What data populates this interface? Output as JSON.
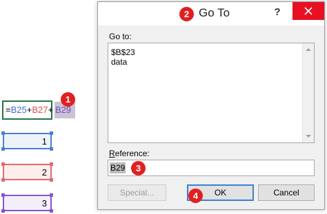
{
  "sheet": {
    "formula": {
      "eq": "=",
      "ref1": "B25",
      "plus1": "+",
      "ref2": "B27",
      "plus2": "+",
      "ref3": "B29"
    },
    "cells": [
      {
        "value": "1",
        "color": "#4a7fd4"
      },
      {
        "value": "2",
        "color": "#e06a6a"
      },
      {
        "value": "3",
        "color": "#8457c8"
      }
    ]
  },
  "badges": [
    "1",
    "2",
    "3",
    "4"
  ],
  "badge_color": "#e02020",
  "dialog": {
    "title": "Go To",
    "help": "?",
    "goto_label": "Go to:",
    "goto_items": [
      "$B$23",
      "data"
    ],
    "reference_label_key": "R",
    "reference_label_rest": "eference:",
    "reference_value": "B29",
    "buttons": {
      "special": "Special...",
      "ok": "OK",
      "cancel": "Cancel"
    },
    "close_color": "#e81123",
    "ok_border_color": "#3c7fd3"
  }
}
